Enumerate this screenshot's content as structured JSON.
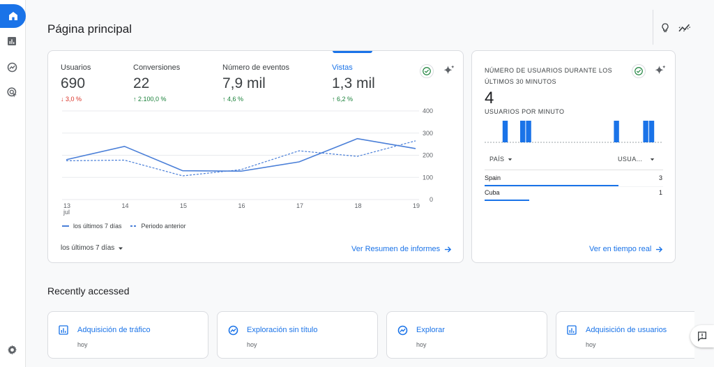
{
  "page": {
    "title": "Página principal"
  },
  "sidebar": {
    "items": [
      {
        "name": "home",
        "icon": "home-icon"
      },
      {
        "name": "reports",
        "icon": "bar-chart-icon"
      },
      {
        "name": "explore",
        "icon": "explore-icon"
      },
      {
        "name": "advertising",
        "icon": "advertising-icon"
      }
    ],
    "settings_icon": "gear-icon"
  },
  "toolbar": {
    "insights_icon": "lightbulb-icon",
    "trend_icon": "trend-icon"
  },
  "overview": {
    "metrics": [
      {
        "label": "Usuarios",
        "value": "690",
        "delta": "3,0 %",
        "direction": "down"
      },
      {
        "label": "Conversiones",
        "value": "22",
        "delta": "2.100,0 %",
        "direction": "up"
      },
      {
        "label": "Número de eventos",
        "value": "7,9 mil",
        "delta": "4,6 %",
        "direction": "up"
      },
      {
        "label": "Vistas",
        "value": "1,3 mil",
        "delta": "6,2 %",
        "direction": "up",
        "selected": true
      }
    ],
    "legend": {
      "current": "los últimos 7 días",
      "previous": "Periodo anterior"
    },
    "date_range": "los últimos 7 días",
    "link": "Ver Resumen de informes"
  },
  "chart_data": {
    "type": "line",
    "x_labels": [
      "13",
      "14",
      "15",
      "16",
      "17",
      "18",
      "19"
    ],
    "x_sublabel": "jul",
    "y_ticks": [
      0,
      100,
      200,
      300,
      400
    ],
    "ylim": [
      0,
      400
    ],
    "grid": true,
    "legend_position": "bottom-left",
    "series": [
      {
        "name": "los últimos 7 días",
        "style": "solid",
        "color": "#4a7fd8",
        "values": [
          180,
          240,
          130,
          128,
          170,
          275,
          230
        ]
      },
      {
        "name": "Periodo anterior",
        "style": "dashed",
        "color": "#4a7fd8",
        "values": [
          175,
          178,
          107,
          135,
          220,
          195,
          265
        ]
      }
    ]
  },
  "realtime": {
    "title": "NÚMERO DE USUARIOS DURANTE LOS ÚLTIMOS 30 MINUTOS",
    "value": "4",
    "subtitle": "USUARIOS POR MINUTO",
    "per_minute": [
      0,
      0,
      1,
      0,
      0,
      1,
      1,
      0,
      0,
      0,
      0,
      0,
      0,
      0,
      0,
      0,
      0,
      0,
      0,
      0,
      0,
      1,
      0,
      0,
      0,
      0,
      1,
      1,
      0,
      0
    ],
    "col_country": "PAÍS",
    "col_users": "USUA...",
    "rows": [
      {
        "country": "Spain",
        "users": "3",
        "share": 1.0
      },
      {
        "country": "Cuba",
        "users": "1",
        "share": 0.333
      }
    ],
    "link": "Ver en tiempo real"
  },
  "recent": {
    "title": "Recently accessed",
    "items": [
      {
        "name": "Adquisición de tráfico",
        "date": "hoy",
        "icon": "bar-chart-icon"
      },
      {
        "name": "Exploración sin título",
        "date": "hoy",
        "icon": "explore-icon"
      },
      {
        "name": "Explorar",
        "date": "hoy",
        "icon": "explore-icon"
      },
      {
        "name": "Adquisición de usuarios",
        "date": "hoy",
        "icon": "bar-chart-icon"
      }
    ]
  },
  "colors": {
    "accent": "#1a73e8",
    "up": "#188038",
    "down": "#d93025"
  }
}
